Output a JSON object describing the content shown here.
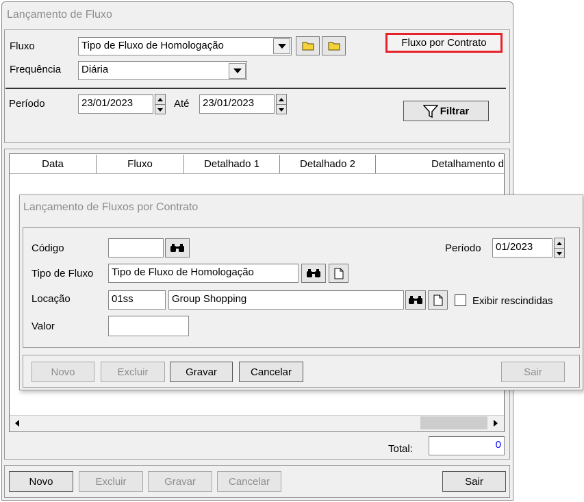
{
  "main_window": {
    "title": "Lançamento de Fluxo",
    "fluxo_label": "Fluxo",
    "fluxo_value": "Tipo de Fluxo de Homologação",
    "fluxo_contrato_button": "Fluxo por Contrato",
    "frequencia_label": "Frequência",
    "frequencia_value": "Diária",
    "periodo_label": "Período",
    "periodo_start": "23/01/2023",
    "ate_label": "Até",
    "periodo_end": "23/01/2023",
    "filtrar_button": "Filtrar",
    "grid_columns": [
      "Data",
      "Fluxo",
      "Detalhado 1",
      "Detalhado 2",
      "Detalhamento d"
    ],
    "total_label": "Total:",
    "total_value": "0",
    "buttons": {
      "novo": "Novo",
      "excluir": "Excluir",
      "gravar": "Gravar",
      "cancelar": "Cancelar",
      "sair": "Sair"
    }
  },
  "dialog": {
    "title": "Lançamento de Fluxos por Contrato",
    "codigo_label": "Código",
    "codigo_value": "",
    "periodo_label": "Período",
    "periodo_value": "01/2023",
    "tipo_fluxo_label": "Tipo de Fluxo",
    "tipo_fluxo_value": "Tipo de Fluxo de Homologação",
    "locacao_label": "Locação",
    "locacao_code": "01ss",
    "locacao_name": "Group Shopping",
    "exibir_rescindidas_label": "Exibir rescindidas",
    "exibir_rescindidas_checked": false,
    "valor_label": "Valor",
    "valor_value": "",
    "buttons": {
      "novo": "Novo",
      "excluir": "Excluir",
      "gravar": "Gravar",
      "cancelar": "Cancelar",
      "sair": "Sair"
    }
  },
  "colors": {
    "highlight_border": "#e8202a",
    "total_value": "#0000ff"
  }
}
